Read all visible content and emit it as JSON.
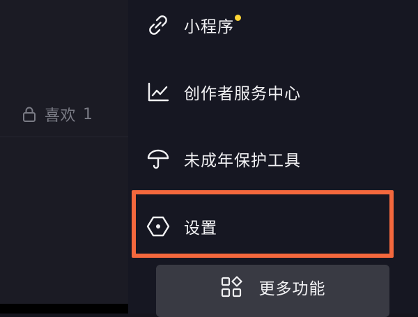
{
  "profile": {
    "likes_tab": {
      "label": "喜欢",
      "count": "1",
      "icon": "lock-icon"
    }
  },
  "menu": {
    "items": [
      {
        "label": "小程序",
        "icon": "link-icon",
        "badge_color": "#ffd535"
      },
      {
        "label": "创作者服务中心",
        "icon": "line-chart-icon"
      },
      {
        "label": "未成年保护工具",
        "icon": "umbrella-icon"
      },
      {
        "label": "设置",
        "icon": "settings-hexagon-icon",
        "highlighted": true
      }
    ],
    "more_button": {
      "label": "更多功能",
      "icon": "apps-grid-icon"
    }
  },
  "colors": {
    "highlight": "#f4683d",
    "badge": "#ffd535",
    "drawer_bg": "#161722",
    "button_bg": "#393a43"
  }
}
